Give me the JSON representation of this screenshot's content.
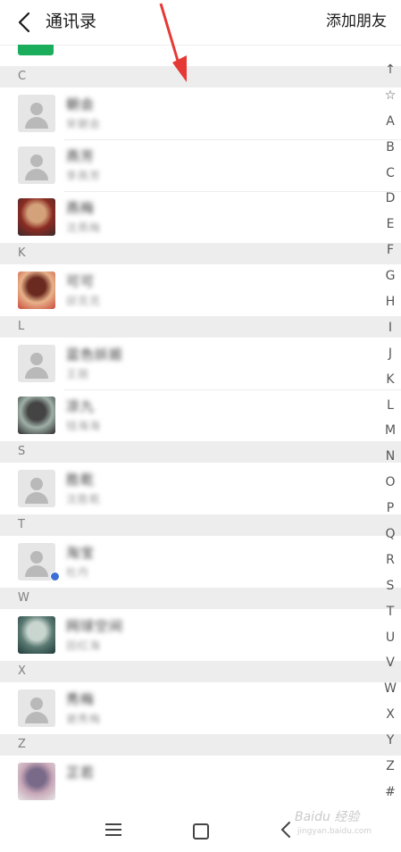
{
  "header": {
    "title": "通讯录",
    "add_friend_label": "添加朋友"
  },
  "sections": [
    {
      "letter": "C",
      "contacts": [
        {
          "name": "朝会",
          "remark": "宋朝会",
          "avatar": "default"
        },
        {
          "name": "燕芳",
          "remark": "李燕芳",
          "avatar": "default"
        },
        {
          "name": "燕梅",
          "remark": "沈燕梅",
          "avatar": "photo"
        }
      ]
    },
    {
      "letter": "K",
      "contacts": [
        {
          "name": "可可",
          "remark": "邱克克",
          "avatar": "photo"
        }
      ]
    },
    {
      "letter": "L",
      "contacts": [
        {
          "name": "蓝色妖姬",
          "remark": "王丽",
          "avatar": "default"
        },
        {
          "name": "凉九",
          "remark": "钱海海",
          "avatar": "photo"
        }
      ]
    },
    {
      "letter": "S",
      "contacts": [
        {
          "name": "胜乾",
          "remark": "沈胜乾",
          "avatar": "default"
        }
      ]
    },
    {
      "letter": "T",
      "contacts": [
        {
          "name": "淘宝",
          "remark": "杜丹",
          "avatar": "default"
        }
      ]
    },
    {
      "letter": "W",
      "contacts": [
        {
          "name": "网球空间",
          "remark": "田红海",
          "avatar": "photo"
        }
      ]
    },
    {
      "letter": "X",
      "contacts": [
        {
          "name": "秀梅",
          "remark": "谢秀梅",
          "avatar": "default"
        }
      ]
    },
    {
      "letter": "Z",
      "contacts": [
        {
          "name": "芷若",
          "remark": "",
          "avatar": "photo"
        }
      ]
    }
  ],
  "index_letters": [
    "↑",
    "☆",
    "A",
    "B",
    "C",
    "D",
    "E",
    "F",
    "G",
    "H",
    "I",
    "J",
    "K",
    "L",
    "M",
    "N",
    "O",
    "P",
    "Q",
    "R",
    "S",
    "T",
    "U",
    "V",
    "W",
    "X",
    "Y",
    "Z",
    "#"
  ],
  "watermark": {
    "main": "Baidu 经验",
    "sub": "jingyan.baidu.com"
  }
}
